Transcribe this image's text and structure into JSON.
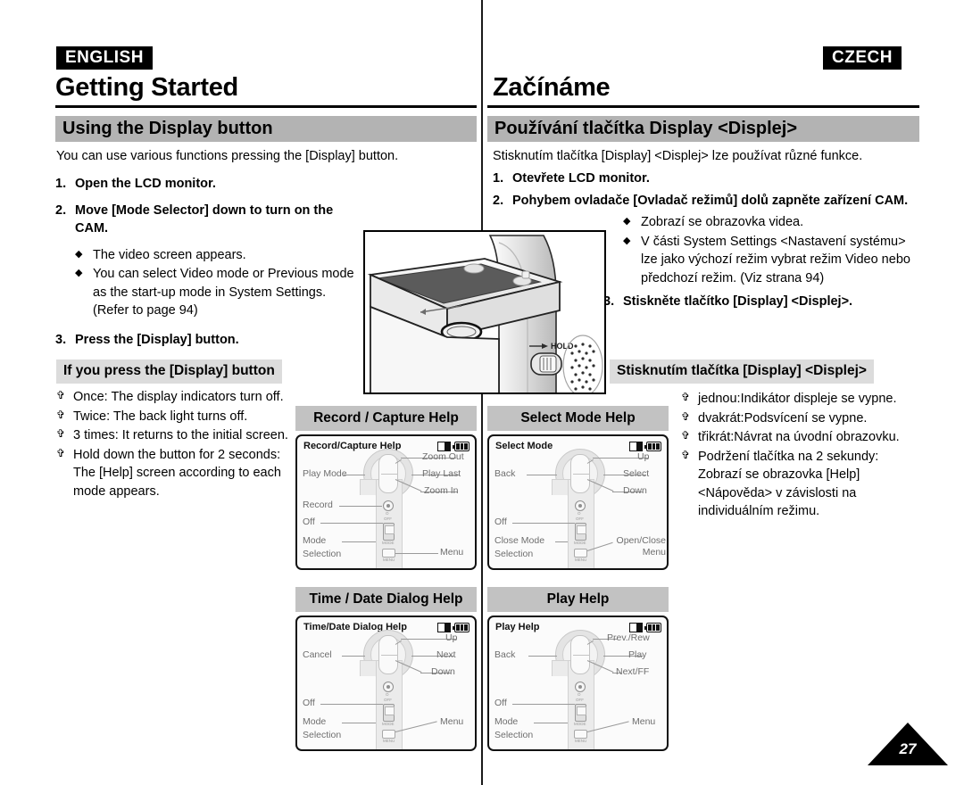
{
  "header": {
    "lang_left": "ENGLISH",
    "lang_right": "CZECH",
    "chapter_left": "Getting Started",
    "chapter_right": "Začínáme",
    "section_left": "Using the Display button",
    "section_right": "Používání tlačítka Display <Displej>"
  },
  "left": {
    "intro": "You can use various functions pressing the [Display] button.",
    "steps": [
      {
        "num": "1.",
        "text": "Open the LCD monitor.",
        "bullets": []
      },
      {
        "num": "2.",
        "text": "Move [Mode Selector] down to turn on the CAM.",
        "bullets": [
          "The video screen appears.",
          "You can select Video mode or Previous mode as the start-up mode in System Settings. (Refer to page 94)"
        ]
      },
      {
        "num": "3.",
        "text": "Press the [Display] button.",
        "bullets": []
      }
    ],
    "highlight": "If you press the [Display] button",
    "clover_items": [
      "Once: The display indicators turn off.",
      "Twice: The back light turns off.",
      "3 times: It returns to the initial screen.",
      "Hold down the button for 2 seconds: The [Help] screen according to each mode appears."
    ]
  },
  "right": {
    "intro": "Stisknutím tlačítka [Display] <Displej> lze používat různé funkce.",
    "steps": [
      {
        "num": "1.",
        "text": "Otevřete LCD monitor.",
        "bullets": []
      },
      {
        "num": "2.",
        "text": "Pohybem ovladače [Ovladač režimů] dolů zapněte zařízení CAM.",
        "bullets": [
          "Zobrazí se obrazovka videa.",
          "V části System Settings <Nastavení systému> lze jako výchozí režim vybrat režim Video nebo předchozí režim. (Viz strana 94)"
        ]
      },
      {
        "num": "3.",
        "text": "Stiskněte tlačítko [Display] <Displej>.",
        "bullets": []
      }
    ],
    "highlight": "Stisknutím tlačítka [Display] <Displej>",
    "clover_items": [
      "jednou:Indikátor displeje se vypne.",
      "dvakrát:Podsvícení se vypne.",
      "třikrát:Návrat na úvodní obrazovku.",
      "Podržení tlačítka na 2 sekundy: Zobrazí se obrazovka [Help] <Nápověda> v závislosti na individuálním režimu."
    ]
  },
  "help_panels": [
    {
      "caption": "Record / Capture Help",
      "lcd_title": "Record/Capture Help",
      "labels": {
        "top_right": "Zoom Out",
        "mid_right": "Play Last",
        "low_right": "Zoom In",
        "mid_left": "Play Mode",
        "rec_left": "Record",
        "off_left": "Off",
        "mode_left_1": "Mode",
        "mode_left_2": "Selection",
        "menu_right": "Menu"
      }
    },
    {
      "caption": "Select Mode Help",
      "lcd_title": "Select Mode",
      "labels": {
        "top_right": "Up",
        "mid_right": "Select",
        "low_right": "Down",
        "mid_left": "Back",
        "rec_left": "",
        "off_left": "Off",
        "mode_left_1": "Close Mode",
        "mode_left_2": "Selection",
        "menu_right": "Open/Close Menu"
      }
    },
    {
      "caption": "Time / Date Dialog Help",
      "lcd_title": "Time/Date Dialog Help",
      "labels": {
        "top_right": "Up",
        "mid_right": "Next",
        "low_right": "Down",
        "mid_left": "Cancel",
        "rec_left": "",
        "off_left": "Off",
        "mode_left_1": "Mode",
        "mode_left_2": "Selection",
        "menu_right": "Menu"
      }
    },
    {
      "caption": "Play Help",
      "lcd_title": "Play Help",
      "labels": {
        "top_right": "Prev./Rew",
        "mid_right": "Play",
        "low_right": "Next/FF",
        "mid_left": "Back",
        "rec_left": "",
        "off_left": "Off",
        "mode_left_1": "Mode",
        "mode_left_2": "Selection",
        "menu_right": "Menu"
      }
    }
  ],
  "illustration": {
    "hold_label": "HOLD"
  },
  "page_number": "27",
  "colors": {
    "section_bar": "#b3b3b3",
    "caption_bar": "#c2c2c2",
    "highlight": "#dcdcdc",
    "tag_bg": "#000000",
    "label_gray": "#6e6e6e"
  }
}
